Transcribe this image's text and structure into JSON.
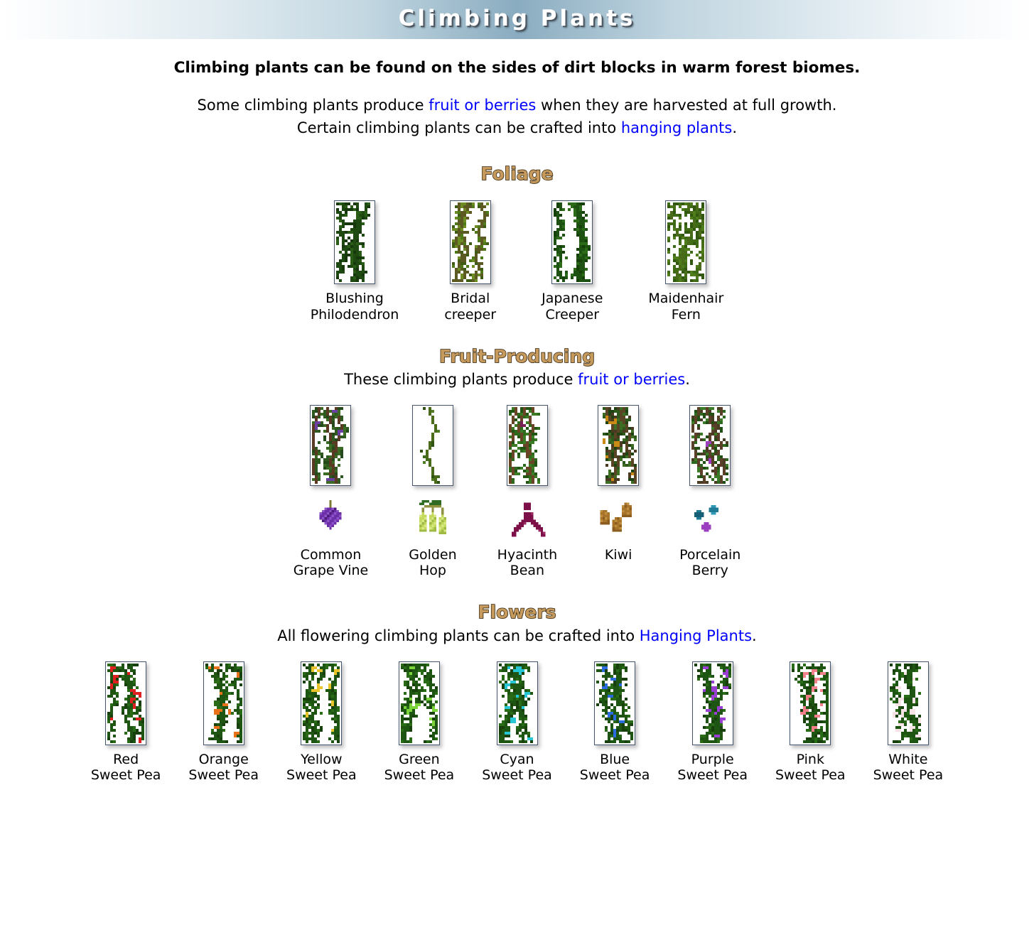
{
  "header": {
    "title": "Climbing Plants"
  },
  "intro": {
    "lead": "Climbing plants can be found on the sides of dirt blocks in warm forest biomes.",
    "line2_before": "Some climbing plants produce ",
    "line2_link": "fruit or berries",
    "line2_after": " when they are harvested at full growth.",
    "line3_before": "Certain climbing plants can be crafted into ",
    "line3_link": "hanging plants",
    "line3_after": "."
  },
  "sections": [
    {
      "id": "foliage",
      "title": "Foliage",
      "subtitle": null,
      "subtitle_link": null,
      "subtitle_after": null
    },
    {
      "id": "fruit-producing",
      "title": "Fruit-Producing",
      "subtitle": "These climbing plants produce ",
      "subtitle_link": "fruit or berries",
      "subtitle_after": "."
    },
    {
      "id": "flowers",
      "title": "Flowers",
      "subtitle": "All flowering climbing plants can be crafted into ",
      "subtitle_link": "Hanging Plants",
      "subtitle_after": "."
    }
  ],
  "foliage_plants": [
    {
      "label": "Blushing\nPhilodendron",
      "texture": {
        "kind": "vine",
        "leaf_colors": [
          "#1e4a11",
          "#2a5d16",
          "#16380c"
        ],
        "density": 0.68,
        "stem_color": "#1e4a11",
        "seed": 11
      }
    },
    {
      "label": "Bridal\ncreeper",
      "texture": {
        "kind": "vine",
        "leaf_colors": [
          "#4e7a18",
          "#6d8c24",
          "#5c5a22",
          "#3f5c14"
        ],
        "density": 0.56,
        "stem_color": "#5c5a22",
        "seed": 23
      }
    },
    {
      "label": "Japanese\nCreeper",
      "texture": {
        "kind": "vine",
        "leaf_colors": [
          "#1d5212",
          "#2c6b18",
          "#154008"
        ],
        "density": 0.55,
        "stem_color": "#1d5212",
        "seed": 37
      }
    },
    {
      "label": "Maidenhair\nFern",
      "texture": {
        "kind": "fern",
        "leaf_colors": [
          "#3f6a16",
          "#4f7d1c",
          "#32580f"
        ],
        "density": 0.46,
        "stem_color": "#4a6b1a",
        "seed": 51
      }
    }
  ],
  "fruit_plants": [
    {
      "label": "Common\nGrape Vine",
      "texture": {
        "kind": "vine",
        "leaf_colors": [
          "#2f5a1f",
          "#3c6b24",
          "#24491a"
        ],
        "density": 0.72,
        "stem_color": "#5a3a22",
        "berry_color": "#6a3fa0",
        "berry_density": 0.02,
        "seed": 61
      },
      "fruit": {
        "name": "grape-cluster-icon",
        "shape": "grape",
        "colors": {
          "main": "#6d2fa8",
          "dark": "#4c1b7a",
          "light": "#8c52c8",
          "stem": "#7a7a30"
        }
      }
    },
    {
      "label": "Golden\nHop",
      "texture": {
        "kind": "sparse",
        "leaf_colors": [
          "#3f6b1c",
          "#4f7d22",
          "#2f5414"
        ],
        "density": 0.3,
        "stem_color": "#4a6b1a",
        "seed": 73
      },
      "fruit": {
        "name": "hop-cones-icon",
        "shape": "hop",
        "colors": {
          "main": "#c3d95c",
          "dark": "#9fbb44",
          "light": "#d8e884",
          "stem": "#8f9340",
          "leaf": "#2f6b22"
        }
      }
    },
    {
      "label": "Hyacinth\nBean",
      "texture": {
        "kind": "vine",
        "leaf_colors": [
          "#2d6a1c",
          "#3b7d24",
          "#225413"
        ],
        "density": 0.58,
        "stem_color": "#6a4426",
        "berry_color": "#7a1f55",
        "berry_density": 0.012,
        "seed": 89
      },
      "fruit": {
        "name": "bean-pod-icon",
        "shape": "bean",
        "colors": {
          "main": "#7d1049",
          "dark": "#5a0a33",
          "light": "#9c2a63"
        }
      }
    },
    {
      "label": "Kiwi",
      "texture": {
        "kind": "vine",
        "leaf_colors": [
          "#2d5a1c",
          "#3d6e24",
          "#1f4213",
          "#4a3a22"
        ],
        "density": 0.74,
        "stem_color": "#5a4426",
        "berry_color": "#c98a16",
        "berry_density": 0.035,
        "seed": 101
      },
      "fruit": {
        "name": "kiwi-fruit-icon",
        "shape": "kiwi",
        "colors": {
          "main": "#a8742a",
          "dark": "#8a5c1e",
          "light": "#c08f3e"
        }
      }
    },
    {
      "label": "Porcelain\nBerry",
      "texture": {
        "kind": "vine",
        "leaf_colors": [
          "#2d6a1f",
          "#3b7d26",
          "#205014",
          "#4a3b24"
        ],
        "density": 0.6,
        "stem_color": "#5a4028",
        "berry_color": "#2b74b8",
        "berry_color2": "#9b3fc0",
        "berry_density": 0.016,
        "seed": 113
      },
      "fruit": {
        "name": "porcelain-berry-icon",
        "shape": "berries",
        "colors": {
          "main": "#1f7a96",
          "dark": "#175f77",
          "light": "#2e9ab5",
          "accent": "#9b3fc0"
        }
      }
    }
  ],
  "flower_plants": [
    {
      "label": "Red\nSweet Pea",
      "flower_color": "#e02020",
      "seed": 201
    },
    {
      "label": "Orange\nSweet Pea",
      "flower_color": "#e8711a",
      "seed": 202
    },
    {
      "label": "Yellow\nSweet Pea",
      "flower_color": "#e8c32a",
      "seed": 203
    },
    {
      "label": "Green\nSweet Pea",
      "flower_color": "#7ad43a",
      "seed": 204
    },
    {
      "label": "Cyan\nSweet Pea",
      "flower_color": "#27c6d4",
      "seed": 205
    },
    {
      "label": "Blue\nSweet Pea",
      "flower_color": "#2a6be0",
      "seed": 206
    },
    {
      "label": "Purple\nSweet Pea",
      "flower_color": "#9b3fd4",
      "seed": 207
    },
    {
      "label": "Pink\nSweet Pea",
      "flower_color": "#f4808c",
      "seed": 208
    },
    {
      "label": "White\nSweet Pea",
      "flower_color": "#f7e3e6",
      "seed": 209
    }
  ],
  "flower_leaf_colors": [
    "#1f5512",
    "#2a6b18",
    "#17400c"
  ],
  "colors": {
    "link": "#0000FF",
    "section_heading": "#c59a5c",
    "section_heading_outline": "#2b1d09",
    "tile_border": "#44546a",
    "banner_center": "#8aacc0",
    "text": "#000000",
    "background": "#ffffff"
  },
  "tile_size": {
    "foliage_w": 52,
    "foliage_h": 112,
    "fruit_w": 52,
    "fruit_h": 108,
    "flower_w": 52,
    "flower_h": 112
  }
}
